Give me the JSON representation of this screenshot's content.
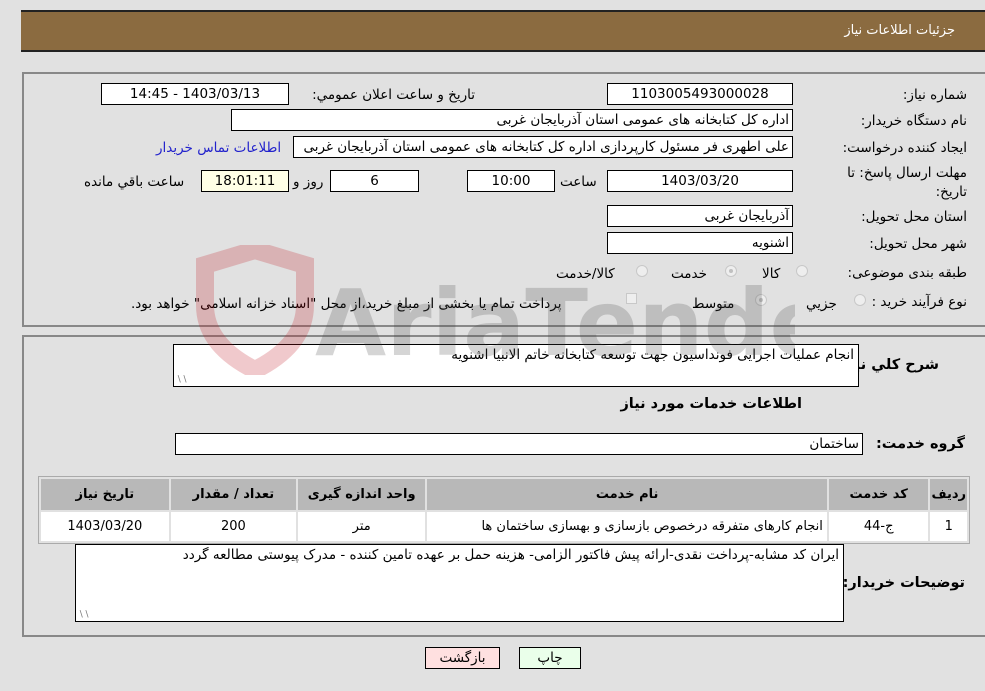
{
  "header": {
    "title": "جزئیات اطلاعات نیاز"
  },
  "form": {
    "need_number": {
      "label": "شماره نیاز:",
      "value": "1103005493000028"
    },
    "announce_datetime": {
      "label": "تاریخ و ساعت اعلان عمومي:",
      "value": "1403/03/13 - 14:45"
    },
    "buyer_org": {
      "label": "نام دستگاه خریدار:",
      "value": "اداره کل کتابخانه های عمومی استان آذربایجان غربی"
    },
    "requester": {
      "label": "ایجاد کننده درخواست:",
      "value": "علی اطهری فر مسئول کارپردازی اداره کل کتابخانه های عمومی استان آذربایجان غربی",
      "contact_link": "اطلاعات تماس خریدار"
    },
    "deadline": {
      "label": "مهلت ارسال پاسخ: تا تاریخ:",
      "date": "1403/03/20",
      "time_label": "ساعت",
      "time": "10:00",
      "days": "6",
      "days_label": "روز و",
      "remaining": "18:01:11",
      "remaining_label": "ساعت باقي مانده"
    },
    "delivery_province": {
      "label": "استان محل تحویل:",
      "value": "آذربایجان غربی"
    },
    "delivery_city": {
      "label": "شهر محل تحویل:",
      "value": "اشنویه"
    },
    "category": {
      "label": "طبقه بندی موضوعی:",
      "options": [
        "کالا",
        "خدمت",
        "کالا/خدمت"
      ],
      "selected": "خدمت"
    },
    "purchase_type": {
      "label": "نوع فرآیند خرید :",
      "options": [
        "جزيي",
        "متوسط"
      ],
      "selected": "متوسط",
      "treasury_note": "پرداخت تمام یا بخشی از مبلغ خرید،از محل \"اسناد خزانه اسلامی\" خواهد بود."
    }
  },
  "description": {
    "label": "شرح كلي نياز:",
    "value": "انجام عملیات اجرایی فونداسیون جهت توسعه کتابخانه خاتم الانبیا اشنویه"
  },
  "services_section": {
    "title": "اطلاعات خدمات مورد نياز",
    "group_label": "گروه خدمت:",
    "group_value": "ساختمان",
    "table": {
      "headers": [
        "ردیف",
        "کد خدمت",
        "نام خدمت",
        "واحد اندازه گیری",
        "تعداد / مقدار",
        "تاریخ نیاز"
      ],
      "rows": [
        [
          "1",
          "ج-44",
          "انجام کارهای متفرقه درخصوص بازسازی و بهسازی ساختمان ها",
          "متر",
          "200",
          "1403/03/20"
        ]
      ]
    }
  },
  "buyer_notes": {
    "label": "توضيحات خريدار:",
    "value": "ایران کد مشابه-پرداخت نقدی-ارائه پیش فاکتور الزامی- هزینه حمل بر عهده تامین کننده -  مدرک پیوستی مطالعه گردد"
  },
  "buttons": {
    "print": "چاپ",
    "back": "بازگشت"
  },
  "colors": {
    "header_bg": "#8b6b40",
    "print_bg": "#eaffea",
    "back_bg": "#ffe0e0",
    "link": "#2222cc"
  },
  "watermark": {
    "text": "AriaTender.neT"
  }
}
